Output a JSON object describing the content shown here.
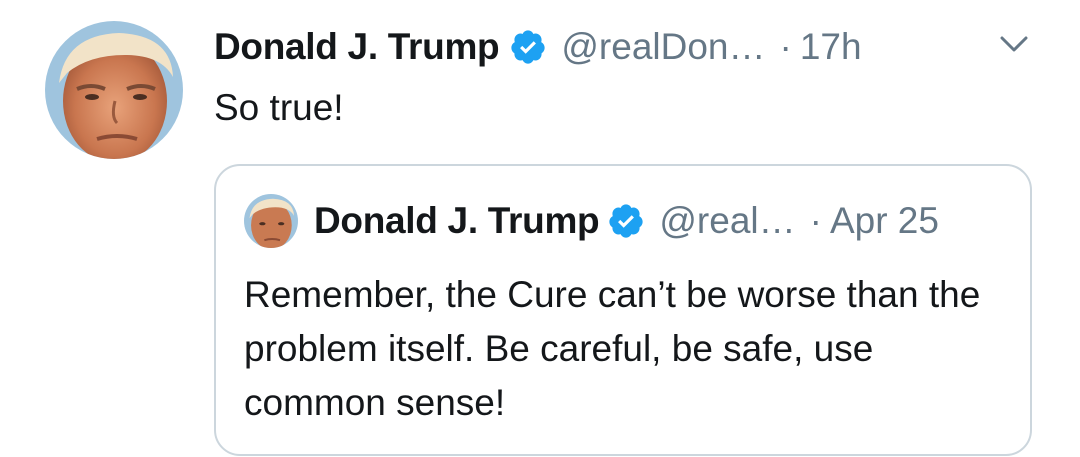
{
  "tweet": {
    "author_name": "Donald J. Trump",
    "handle": "@realDon…",
    "separator": "·",
    "time": "17h",
    "text": "So true!",
    "menu_icon": "chevron-down-icon",
    "verified_icon": "verified-badge-icon"
  },
  "quoted_tweet": {
    "author_name": "Donald J. Trump",
    "handle": "@real…",
    "separator": "·",
    "time": "Apr 25",
    "text": "Remember, the Cure can’t be worse than the problem itself. Be careful, be safe, use common sense!"
  },
  "colors": {
    "verified_blue": "#1da1f2",
    "text_primary": "#14171a",
    "text_secondary": "#657786",
    "border": "#ccd6dd"
  }
}
